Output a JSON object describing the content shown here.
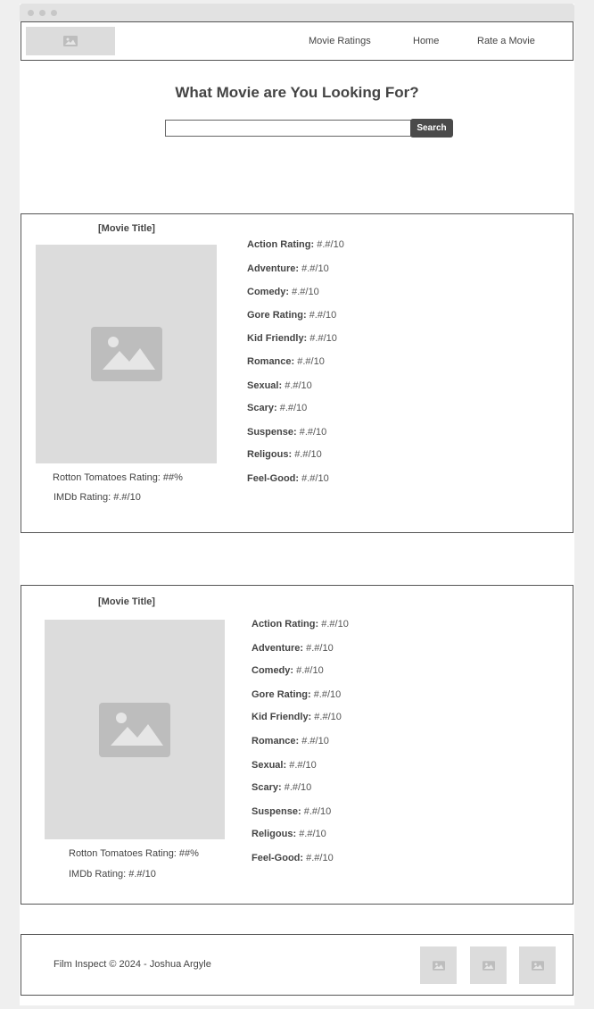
{
  "nav": {
    "links": [
      "Movie Ratings",
      "Home",
      "Rate a Movie"
    ]
  },
  "hero": {
    "title": "What Movie are You Looking For?",
    "search_value": "",
    "search_button": "Search"
  },
  "movies": [
    {
      "title": "[Movie Title]",
      "rt": "Rotton Tomatoes Rating: ##%",
      "imdb": "IMDb Rating: #.#/10",
      "ratings": [
        {
          "label": "Action Rating:",
          "value": "#.#/10"
        },
        {
          "label": "Adventure:",
          "value": "#.#/10"
        },
        {
          "label": "Comedy:",
          "value": "#.#/10"
        },
        {
          "label": "Gore Rating:",
          "value": "#.#/10"
        },
        {
          "label": "Kid Friendly:",
          "value": "#.#/10"
        },
        {
          "label": "Romance:",
          "value": "#.#/10"
        },
        {
          "label": "Sexual:",
          "value": "#.#/10"
        },
        {
          "label": "Scary:",
          "value": "#.#/10"
        },
        {
          "label": "Suspense:",
          "value": "#.#/10"
        },
        {
          "label": "Religous:",
          "value": "#.#/10"
        },
        {
          "label": "Feel-Good:",
          "value": "#.#/10"
        }
      ]
    },
    {
      "title": "[Movie Title]",
      "rt": "Rotton Tomatoes Rating: ##%",
      "imdb": "IMDb Rating: #.#/10",
      "ratings": [
        {
          "label": "Action Rating:",
          "value": "#.#/10"
        },
        {
          "label": "Adventure:",
          "value": "#.#/10"
        },
        {
          "label": "Comedy:",
          "value": "#.#/10"
        },
        {
          "label": "Gore Rating:",
          "value": "#.#/10"
        },
        {
          "label": "Kid Friendly:",
          "value": "#.#/10"
        },
        {
          "label": "Romance:",
          "value": "#.#/10"
        },
        {
          "label": "Sexual:",
          "value": "#.#/10"
        },
        {
          "label": "Scary:",
          "value": "#.#/10"
        },
        {
          "label": "Suspense:",
          "value": "#.#/10"
        },
        {
          "label": "Religous:",
          "value": "#.#/10"
        },
        {
          "label": "Feel-Good:",
          "value": "#.#/10"
        }
      ]
    }
  ],
  "footer": {
    "text": "Film Inspect © 2024 - Joshua Argyle",
    "social_icons": [
      "image-icon",
      "image-icon",
      "image-icon"
    ]
  },
  "colors": {
    "placeholder_bg": "#dcdcdc",
    "button_bg": "#4a4a4a",
    "border": "#555555"
  }
}
